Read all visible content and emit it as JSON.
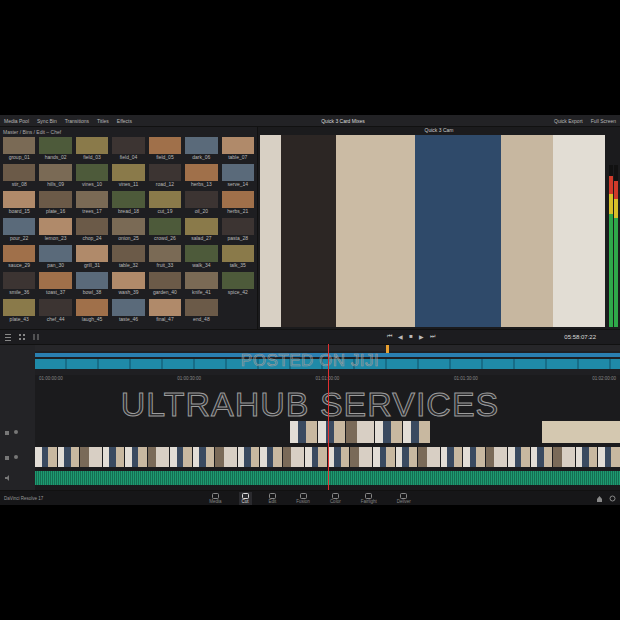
{
  "window": {
    "title": "Quick 3 Card Mixes"
  },
  "toolbar": {
    "left": [
      "Media Pool",
      "Sync Bin",
      "Transitions",
      "Titles",
      "Effects"
    ],
    "right": [
      "Quick Export",
      "Full Screen"
    ]
  },
  "media_pool": {
    "path": "Master / Bins / Edit – Chef",
    "clips": [
      "group_01",
      "hands_02",
      "field_03",
      "field_04",
      "field_05",
      "dark_06",
      "table_07",
      "stir_08",
      "hills_09",
      "vines_10",
      "vines_11",
      "road_12",
      "herbs_13",
      "serve_14",
      "board_15",
      "plate_16",
      "trees_17",
      "bread_18",
      "cut_19",
      "oil_20",
      "herbs_21",
      "pour_22",
      "lemon_23",
      "chop_24",
      "onion_25",
      "crowd_26",
      "salad_27",
      "pasta_28",
      "sauce_29",
      "pan_30",
      "grill_31",
      "table_32",
      "fruit_33",
      "walk_34",
      "talk_35",
      "smile_36",
      "toast_37",
      "bowl_38",
      "wash_39",
      "garden_40",
      "knife_41",
      "spice_42",
      "plate_43",
      "chef_44",
      "laugh_45",
      "taste_46",
      "final_47",
      "end_48"
    ]
  },
  "viewer": {
    "title": "Quick 3 Cam",
    "timecode": "05:58:07:22",
    "controls": [
      "⏮",
      "◀",
      "■",
      "▶",
      "⏭"
    ],
    "meters": [
      {
        "level": 0.93
      },
      {
        "level": 0.9
      }
    ]
  },
  "mini_timeline": {
    "level": 0.6
  },
  "timeline": {
    "playhead": 0.5,
    "ruler": [
      "01:00:00:00",
      "01:00:30:00",
      "01:01:00:00",
      "01:01:30:00",
      "01:02:00:00"
    ]
  },
  "watermarks": [
    "POSTED ON JIJI",
    "ULTRAHUB SERVICES"
  ],
  "pages": [
    {
      "label": "Media",
      "selected": false
    },
    {
      "label": "Cut",
      "selected": true
    },
    {
      "label": "Edit",
      "selected": false
    },
    {
      "label": "Fusion",
      "selected": false
    },
    {
      "label": "Color",
      "selected": false
    },
    {
      "label": "Fairlight",
      "selected": false
    },
    {
      "label": "Deliver",
      "selected": false
    }
  ],
  "app": {
    "name": "DaVinci Resolve 17"
  }
}
